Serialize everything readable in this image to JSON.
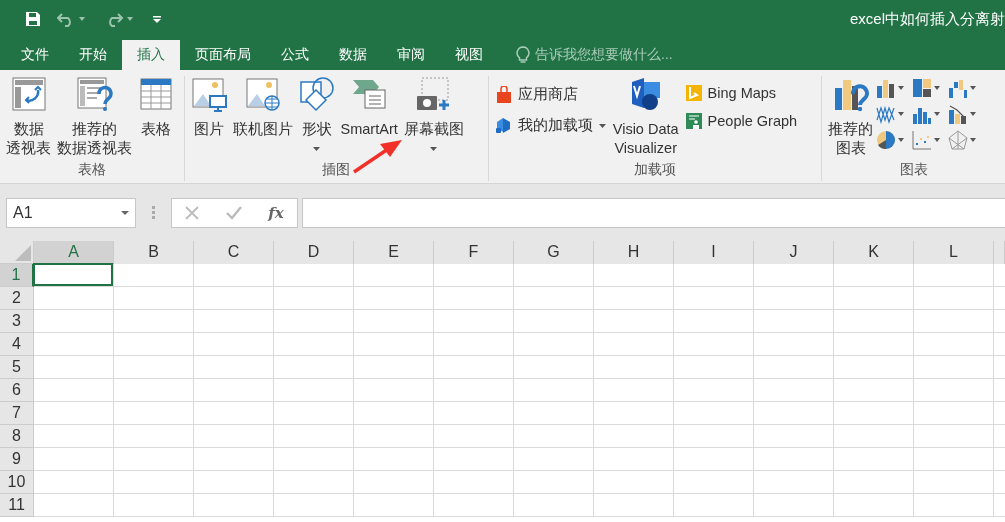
{
  "title_bar": {
    "title": "excel中如何插入分离射"
  },
  "ribbon_tabs": [
    {
      "label": "文件",
      "selected": false
    },
    {
      "label": "开始",
      "selected": false
    },
    {
      "label": "插入",
      "selected": true
    },
    {
      "label": "页面布局",
      "selected": false
    },
    {
      "label": "公式",
      "selected": false
    },
    {
      "label": "数据",
      "selected": false
    },
    {
      "label": "审阅",
      "selected": false
    },
    {
      "label": "视图",
      "selected": false
    }
  ],
  "tell_me": {
    "placeholder": "告诉我您想要做什么..."
  },
  "ribbon_groups": [
    {
      "label": "表格",
      "items": [
        {
          "kind": "large",
          "lines": [
            "数据",
            "透视表"
          ],
          "dropdown": false
        },
        {
          "kind": "large",
          "lines": [
            "推荐的",
            "数据透视表"
          ],
          "dropdown": false
        },
        {
          "kind": "large",
          "lines": [
            "表格"
          ],
          "dropdown": false
        }
      ]
    },
    {
      "label": "插图",
      "items": [
        {
          "kind": "large",
          "lines": [
            "图片"
          ],
          "dropdown": false
        },
        {
          "kind": "large",
          "lines": [
            "联机图片"
          ],
          "dropdown": false
        },
        {
          "kind": "large",
          "lines": [
            "形状"
          ],
          "dropdown": true
        },
        {
          "kind": "large",
          "lines": [
            "SmartArt"
          ],
          "dropdown": false
        },
        {
          "kind": "large",
          "lines": [
            "屏幕截图"
          ],
          "dropdown": true
        }
      ]
    },
    {
      "label": "加载项",
      "items": [
        {
          "kind": "stack",
          "items": [
            {
              "label": "应用商店",
              "dropdown": false
            },
            {
              "label": "我的加载项",
              "dropdown": true
            }
          ]
        },
        {
          "kind": "large",
          "lines": [
            "Visio Data",
            "Visualizer"
          ],
          "dropdown": false
        },
        {
          "kind": "stack",
          "items": [
            {
              "label": "Bing Maps",
              "dropdown": false
            },
            {
              "label": "People Graph",
              "dropdown": false
            }
          ]
        }
      ]
    },
    {
      "label": "图表",
      "items": [
        {
          "kind": "large",
          "lines": [
            "推荐的",
            "图表"
          ],
          "dropdown": false
        },
        {
          "kind": "grid",
          "items": [
            {
              "dropdown": true
            },
            {
              "dropdown": true
            },
            {
              "dropdown": true
            },
            {
              "dropdown": true
            },
            {
              "dropdown": true
            },
            {
              "dropdown": true
            },
            {
              "dropdown": true
            },
            {
              "dropdown": true
            },
            {
              "dropdown": true
            }
          ]
        }
      ]
    }
  ],
  "formula_bar": {
    "name_box": "A1",
    "function_label": "fx"
  },
  "columns": [
    {
      "label": "A",
      "selected": true
    },
    {
      "label": "B",
      "selected": false
    },
    {
      "label": "C",
      "selected": false
    },
    {
      "label": "D",
      "selected": false
    },
    {
      "label": "E",
      "selected": false
    },
    {
      "label": "F",
      "selected": false
    },
    {
      "label": "G",
      "selected": false
    },
    {
      "label": "H",
      "selected": false
    },
    {
      "label": "I",
      "selected": false
    },
    {
      "label": "J",
      "selected": false
    },
    {
      "label": "K",
      "selected": false
    },
    {
      "label": "L",
      "selected": false
    }
  ],
  "rows": [
    {
      "label": "1",
      "selected": true
    },
    {
      "label": "2",
      "selected": false
    },
    {
      "label": "3",
      "selected": false
    },
    {
      "label": "4",
      "selected": false
    },
    {
      "label": "5",
      "selected": false
    },
    {
      "label": "6",
      "selected": false
    },
    {
      "label": "7",
      "selected": false
    },
    {
      "label": "8",
      "selected": false
    },
    {
      "label": "9",
      "selected": false
    },
    {
      "label": "10",
      "selected": false
    },
    {
      "label": "11",
      "selected": false
    }
  ]
}
